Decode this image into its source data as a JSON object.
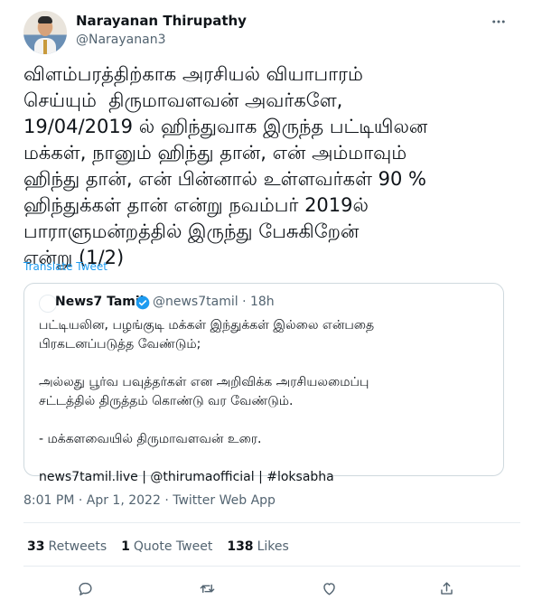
{
  "author": {
    "name": "Narayanan Thirupathy",
    "handle": "@Narayanan3",
    "avatar_icon": "profile-photo"
  },
  "tweet": {
    "text": "விளம்பரத்திற்காக அரசியல் வியாபாரம்\nசெய்யும்  திருமாவளவன் அவர்களே,\n19/04/2019 ல் ஹிந்துவாக இருந்த பட்டியிலன\nமக்கள், நானும் ஹிந்து தான், என் அம்மாவும்\nஹிந்து தான், என் பின்னால் உள்ளவர்கள் 90 %\nஹிந்துக்கள் தான் என்று நவம்பர் 2019ல்\nபாராளுமன்றத்தில் இருந்து பேசுகிறேன்\nஎன்று (1/2)",
    "translate_label": "Translate Tweet"
  },
  "quote": {
    "name": "News7 Tamil",
    "handle_time": "@news7tamil · 18h",
    "verified_color": "#1d9bf0",
    "text": "பட்டியலின, பழங்குடி மக்கள் இந்துக்கள் இல்லை என்பதை\nபிரகடனப்படுத்த வேண்டும்;\n\nஅல்லது பூர்வ பவுத்தர்கள் என அறிவிக்க அரசியலமைப்பு\nசட்டத்தில் திருத்தம் கொண்டு வர வேண்டும்.\n\n- மக்களவையில் திருமாவளவன் உரை.\n\nnews7tamil.live | @thirumaofficial | #loksabha"
  },
  "meta": {
    "timestamp": "8:01 PM · Apr 1, 2022 · Twitter Web App"
  },
  "stats": {
    "retweets_count": "33",
    "retweets_label": "Retweets",
    "quotes_count": "1",
    "quotes_label": "Quote Tweet",
    "likes_count": "138",
    "likes_label": "Likes"
  },
  "colors": {
    "accent": "#1d9bf0",
    "secondary_text": "#536471",
    "border": "#cfd9de"
  }
}
